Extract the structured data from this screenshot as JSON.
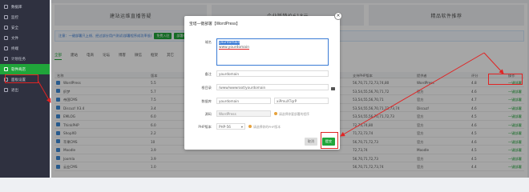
{
  "colors": {
    "accent": "#20a53a",
    "annotation": "#e02424",
    "sidebar_bg": "#2f3140"
  },
  "sidebar": {
    "items": [
      {
        "label": "数据库",
        "icon": "database-icon"
      },
      {
        "label": "监控",
        "icon": "monitor-icon"
      },
      {
        "label": "安全",
        "icon": "shield-icon"
      },
      {
        "label": "文件",
        "icon": "folder-icon"
      },
      {
        "label": "终端",
        "icon": "terminal-icon"
      },
      {
        "label": "计划任务",
        "icon": "clock-icon"
      },
      {
        "label": "软件商店",
        "icon": "app-store-icon",
        "active": true
      },
      {
        "label": "面板设置",
        "icon": "gear-icon"
      },
      {
        "label": "退出",
        "icon": "logout-icon"
      }
    ]
  },
  "banners": [
    "建站运维直播答疑",
    "企业版特价618元",
    "精品软件推荐"
  ],
  "notice": {
    "text": "注意：一键部署只上线、经过部分用户测试(部署程序成功率低)",
    "btn1": "免费入驻",
    "btn2": "部署申请"
  },
  "tabs": [
    "全部",
    "建站",
    "电商",
    "论坛",
    "博客",
    "微信",
    "框架",
    "其它"
  ],
  "table": {
    "headers": [
      "名称",
      "版本",
      "简介",
      "支持PHP版本",
      "提供者",
      "评分",
      "操作"
    ],
    "rows": [
      {
        "name": "WordPress",
        "version": "5.5",
        "php": "56,70,71,72,73,74,80",
        "provider": "WordPress",
        "score": "4.8",
        "action": "一键部署"
      },
      {
        "name": "织梦",
        "version": "5.7",
        "php": "53,54,55,56,70,71,72",
        "provider": "官方",
        "score": "4.6",
        "action": "一键部署"
      },
      {
        "name": "帝国CMS",
        "version": "7.5",
        "php": "53,54,55,56,70,71",
        "provider": "官方",
        "score": "4.7",
        "action": "一键部署"
      },
      {
        "name": "Discuz! X3.4",
        "version": "3.4",
        "php": "53,54,55,56,70,71,72,73,74",
        "provider": "Discuz!",
        "score": "4.6",
        "action": "一键部署"
      },
      {
        "name": "EMLOG",
        "version": "6.0",
        "php": "53,54,55,56,70,71,72,73",
        "provider": "官方",
        "score": "4.5",
        "action": "一键部署"
      },
      {
        "name": "ThinkPHP",
        "version": "6.0",
        "php": "72,73,74,80",
        "provider": "官方",
        "score": "4.6",
        "action": "一键部署"
      },
      {
        "name": "ShopXO",
        "version": "2.2",
        "php": "71,72,73,74",
        "provider": "官方",
        "score": "4.5",
        "action": "一键部署"
      },
      {
        "name": "苹果CMS",
        "version": "10",
        "php": "56,70,71,72,73",
        "provider": "官方",
        "score": "4.6",
        "action": "一键部署"
      },
      {
        "name": "Moodle",
        "version": "3.9",
        "php": "72,73,74",
        "provider": "Moodle",
        "score": "4.5",
        "action": "一键部署"
      },
      {
        "name": "Joomla",
        "version": "3.9",
        "php": "56,70,71,72,73",
        "provider": "官方",
        "score": "4.5",
        "action": "一键部署"
      },
      {
        "name": "云业CMS",
        "version": "1.0",
        "php": "56,70,71,72,73,74",
        "provider": "官方",
        "score": "4.4",
        "action": "一键部署"
      }
    ]
  },
  "modal": {
    "title": "宝塔一键部署【WordPress】",
    "domain_label": "域名",
    "domain_lines": [
      "yourdomain",
      "www.yourdomain"
    ],
    "remark_label": "备注",
    "remark_value": "yourdomain",
    "root_label": "根目录",
    "root_value": "/www/wwwroot/yourdomain",
    "db_label": "数据库",
    "db_user": "yourdomain",
    "db_pass": "xiPmuXTqrP",
    "source_label": "源码",
    "source_value": "WordPress",
    "source_hint": "请选择你要部署的程序",
    "php_label": "PHP版本",
    "php_value": "PHP-56",
    "php_hint": "请选择你的PHP版本",
    "cancel": "取消",
    "submit": "提交"
  }
}
